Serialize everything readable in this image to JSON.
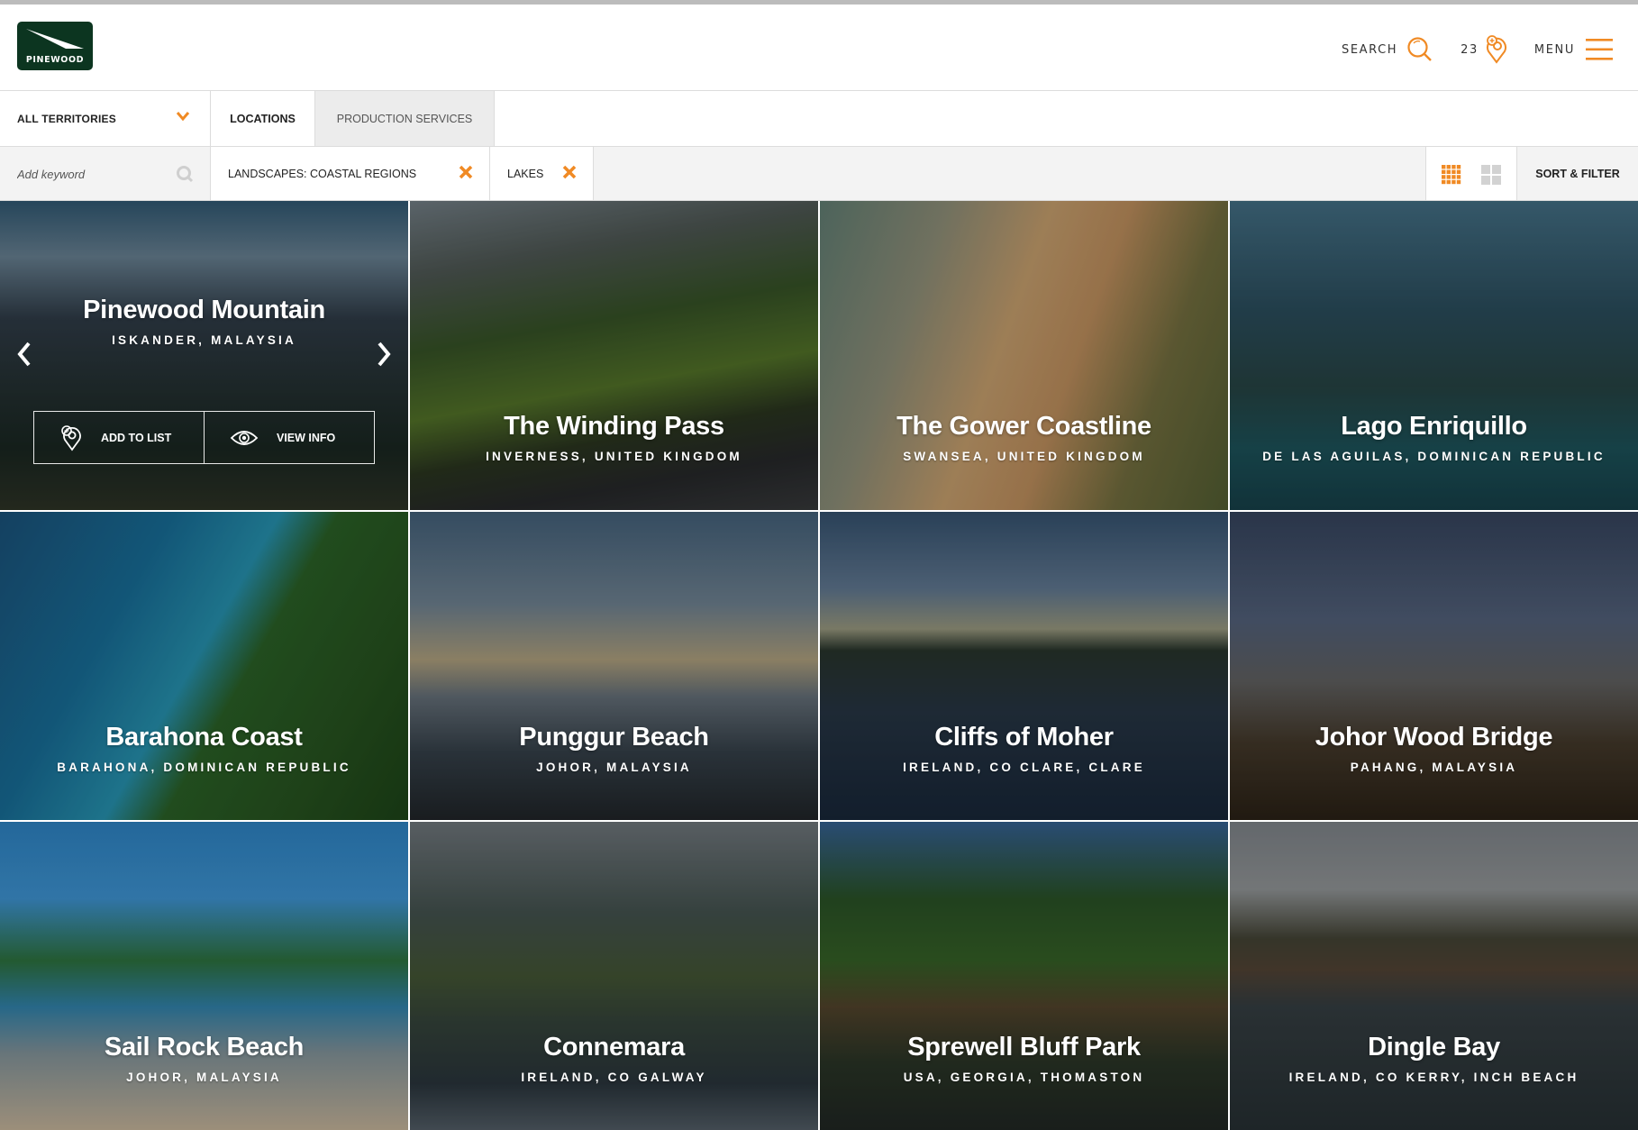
{
  "header": {
    "brand": "PINEWOOD",
    "search_label": "SEARCH",
    "list_count": "23",
    "menu_label": "MENU",
    "accent_color": "#f08a24",
    "logo_color": "#0c3520"
  },
  "filters": {
    "territory": "ALL TERRITORIES",
    "tabs": [
      {
        "label": "LOCATIONS",
        "active": true
      },
      {
        "label": "PRODUCTION SERVICES",
        "active": false
      }
    ],
    "keyword_placeholder": "Add keyword",
    "keyword_value": "",
    "active_filters": [
      {
        "label": "LANDSCAPES: COASTAL REGIONS"
      },
      {
        "label": "LAKES"
      }
    ],
    "view_modes": [
      "small-grid",
      "large-grid"
    ],
    "active_view": "small-grid",
    "sort_filter_label": "SORT & FILTER"
  },
  "locations": [
    {
      "title": "Pinewood Mountain",
      "subtitle": "ISKANDER, MALAYSIA",
      "featured": true,
      "actions": {
        "add": "ADD TO LIST",
        "view": "VIEW INFO"
      }
    },
    {
      "title": "The Winding Pass",
      "subtitle": "INVERNESS, UNITED KINGDOM"
    },
    {
      "title": "The Gower Coastline",
      "subtitle": "SWANSEA, UNITED KINGDOM"
    },
    {
      "title": "Lago Enriquillo",
      "subtitle": "DE LAS AGUILAS, DOMINICAN REPUBLIC"
    },
    {
      "title": "Barahona Coast",
      "subtitle": "BARAHONA, DOMINICAN REPUBLIC"
    },
    {
      "title": "Punggur Beach",
      "subtitle": "JOHOR, MALAYSIA"
    },
    {
      "title": "Cliffs of Moher",
      "subtitle": "IRELAND, CO CLARE, CLARE"
    },
    {
      "title": "Johor Wood Bridge",
      "subtitle": "PAHANG, MALAYSIA"
    },
    {
      "title": "Sail Rock Beach",
      "subtitle": "JOHOR, MALAYSIA"
    },
    {
      "title": "Connemara",
      "subtitle": "IRELAND, CO GALWAY"
    },
    {
      "title": "Sprewell Bluff Park",
      "subtitle": "USA, GEORGIA, THOMASTON"
    },
    {
      "title": "Dingle Bay",
      "subtitle": "IRELAND, CO KERRY, INCH BEACH"
    }
  ]
}
